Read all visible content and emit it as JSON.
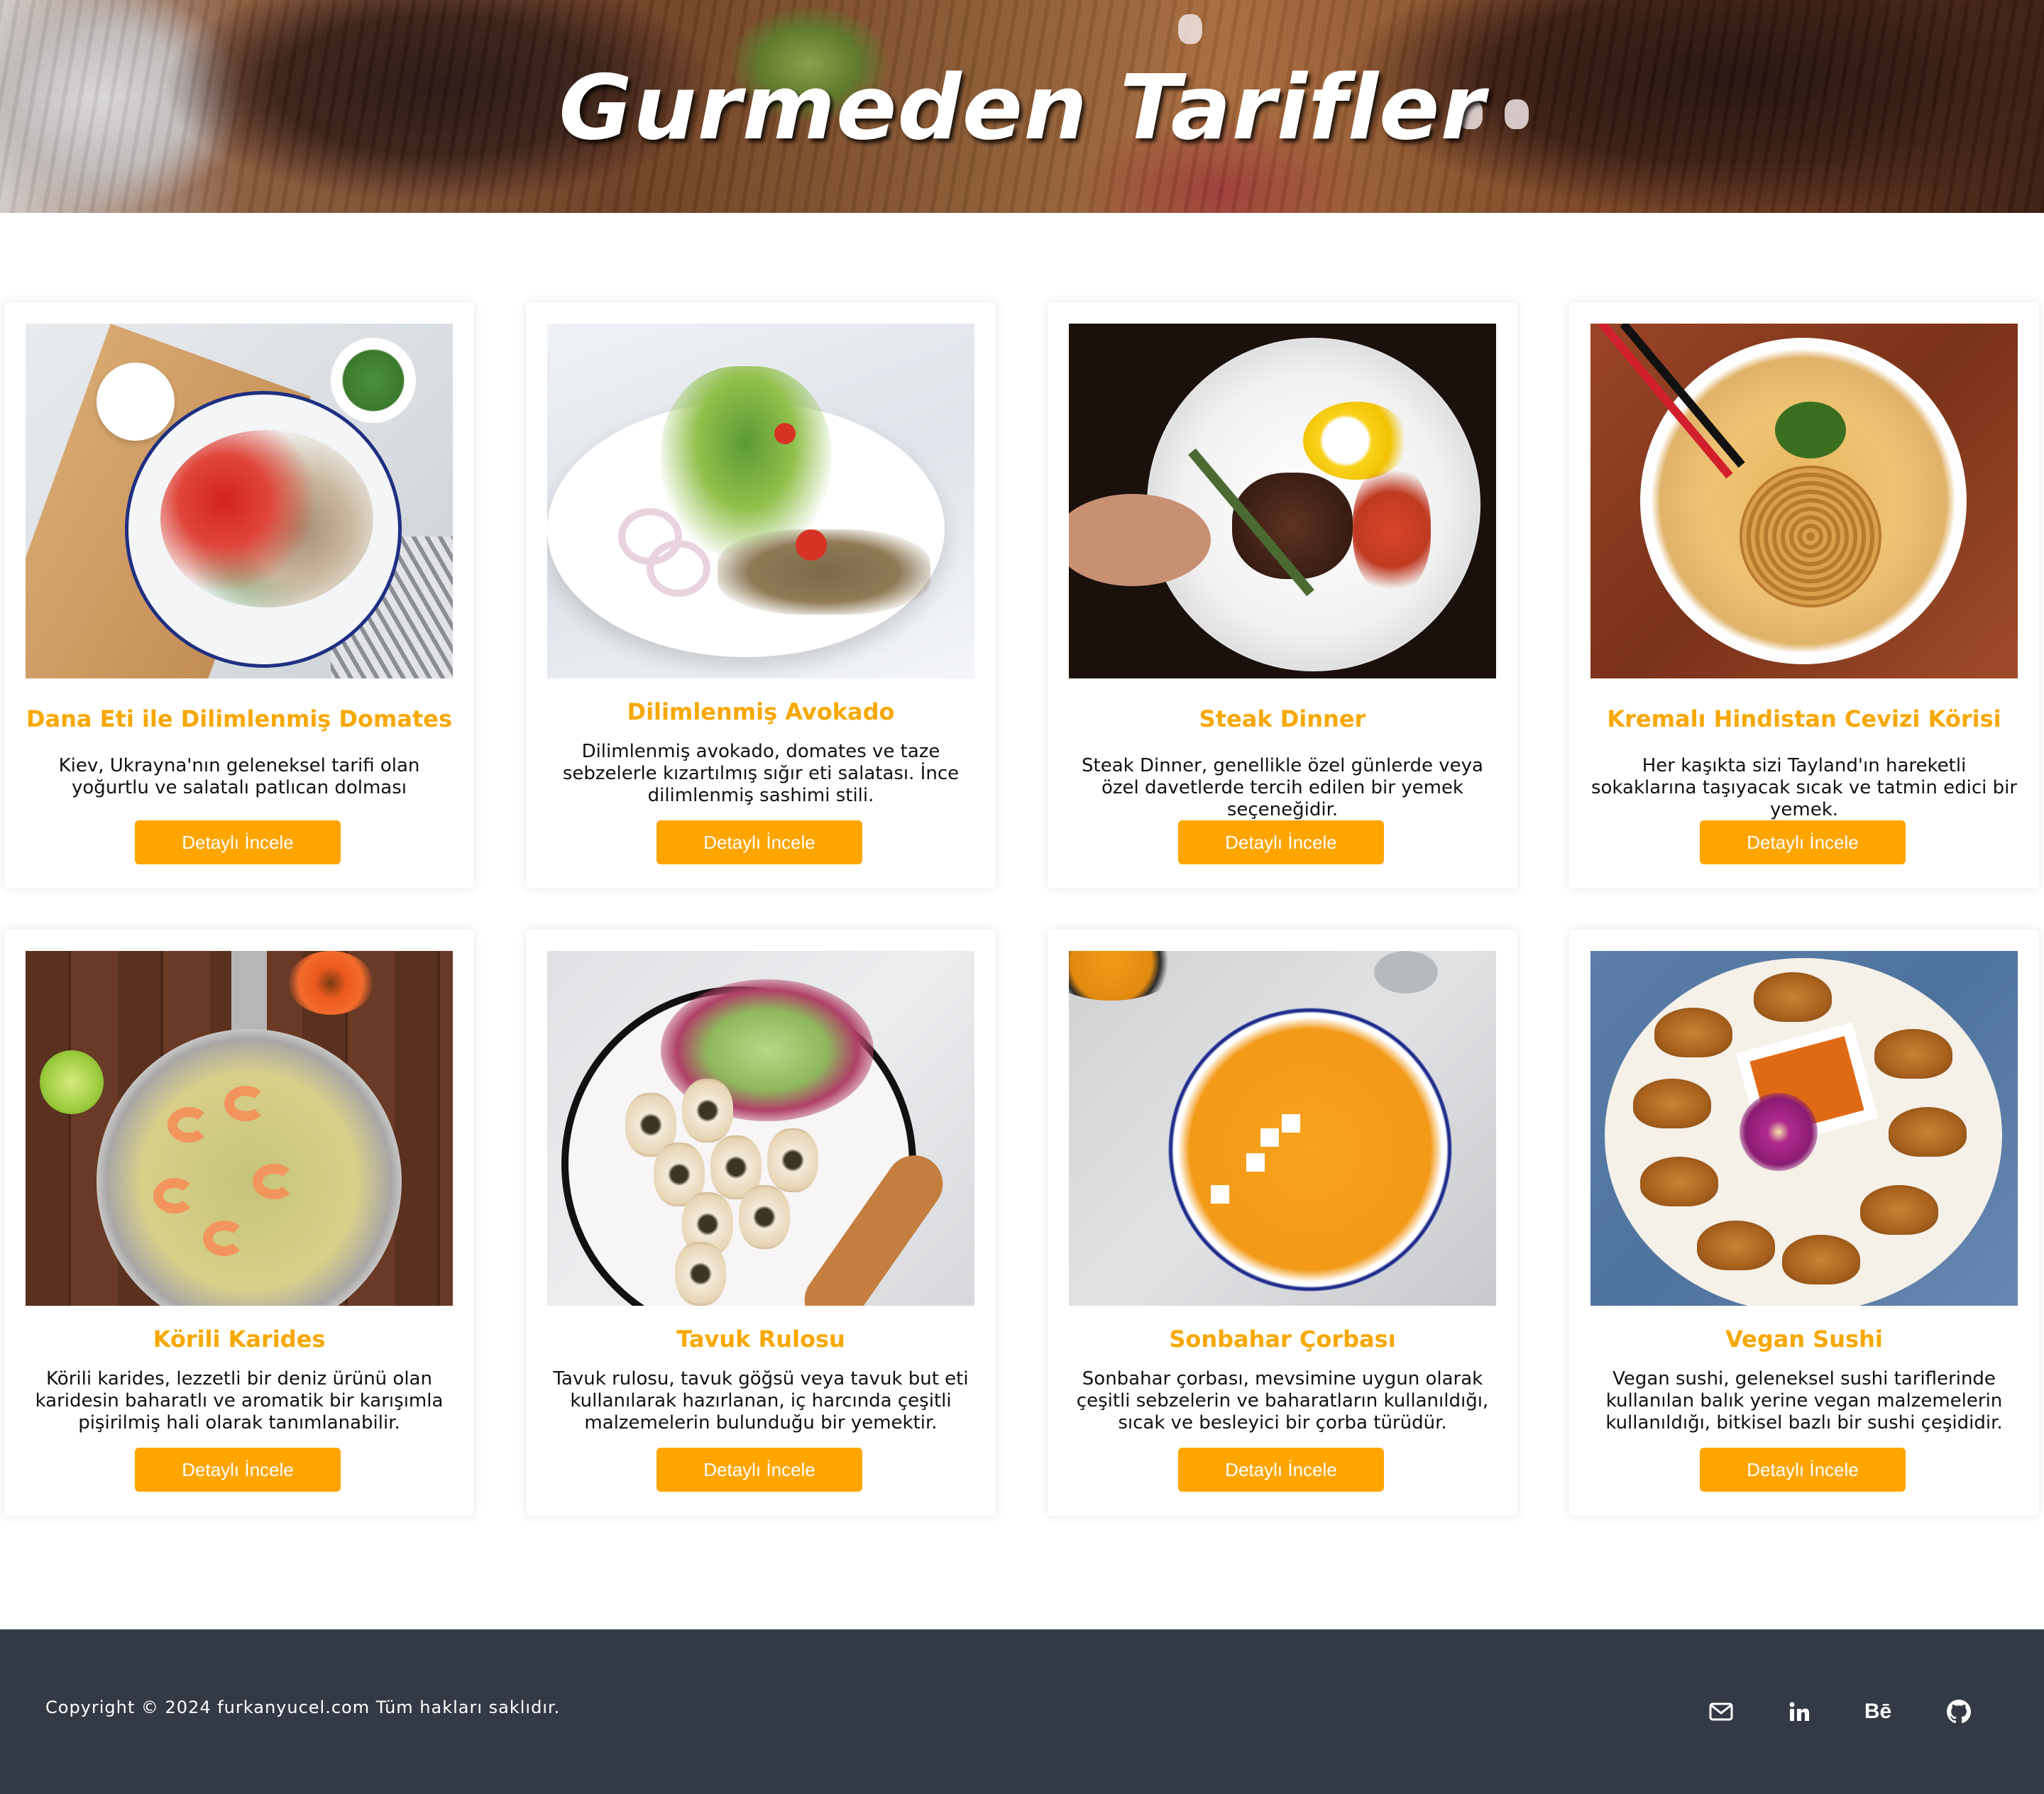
{
  "hero": {
    "title": "Gurmeden Tarifler"
  },
  "recipes": [
    {
      "title": "Dana Eti ile Dilimlenmiş Domates",
      "description": "Kiev, Ukrayna'nın geleneksel tarifi olan yoğurtlu ve salatalı patlıcan dolması",
      "button": "Detaylı İncele"
    },
    {
      "title": "Dilimlenmiş Avokado",
      "description": "Dilimlenmiş avokado, domates ve taze sebzelerle kızartılmış sığır eti salatası. İnce dilimlenmiş sashimi stili.",
      "button": "Detaylı İncele"
    },
    {
      "title": "Steak Dinner",
      "description": "Steak Dinner, genellikle özel günlerde veya özel davetlerde tercih edilen bir yemek seçeneğidir.",
      "button": "Detaylı İncele"
    },
    {
      "title": "Kremalı Hindistan Cevizi Körisi",
      "description": "Her kaşıkta sizi Tayland'ın hareketli sokaklarına taşıyacak sıcak ve tatmin edici bir yemek.",
      "button": "Detaylı İncele"
    },
    {
      "title": "Körili Karides",
      "description": "Körili karides, lezzetli bir deniz ürünü olan karidesin baharatlı ve aromatik bir karışımla pişirilmiş hali olarak tanımlanabilir.",
      "button": "Detaylı İncele"
    },
    {
      "title": "Tavuk Rulosu",
      "description": "Tavuk rulosu, tavuk göğsü veya tavuk but eti kullanılarak hazırlanan, iç harcında çeşitli malzemelerin bulunduğu bir yemektir.",
      "button": "Detaylı İncele"
    },
    {
      "title": "Sonbahar Çorbası",
      "description": "Sonbahar çorbası, mevsimine uygun olarak çeşitli sebzelerin ve baharatların kullanıldığı, sıcak ve besleyici bir çorba türüdür.",
      "button": "Detaylı İncele"
    },
    {
      "title": "Vegan Sushi",
      "description": "Vegan sushi, geleneksel sushi tariflerinde kullanılan balık yerine vegan malzemelerin kullanıldığı, bitkisel bazlı bir sushi çeşididir.",
      "button": "Detaylı İncele"
    }
  ],
  "footer": {
    "copyright": "Copyright © 2024 furkanyucel.com Tüm hakları saklıdır.",
    "social": [
      {
        "icon": "mail-icon"
      },
      {
        "icon": "linkedin-icon"
      },
      {
        "icon": "behance-icon",
        "label": "Bē"
      },
      {
        "icon": "github-icon"
      }
    ]
  },
  "colors": {
    "accent": "#fea500",
    "title": "#f7a800",
    "footer_bg": "#343a45"
  }
}
